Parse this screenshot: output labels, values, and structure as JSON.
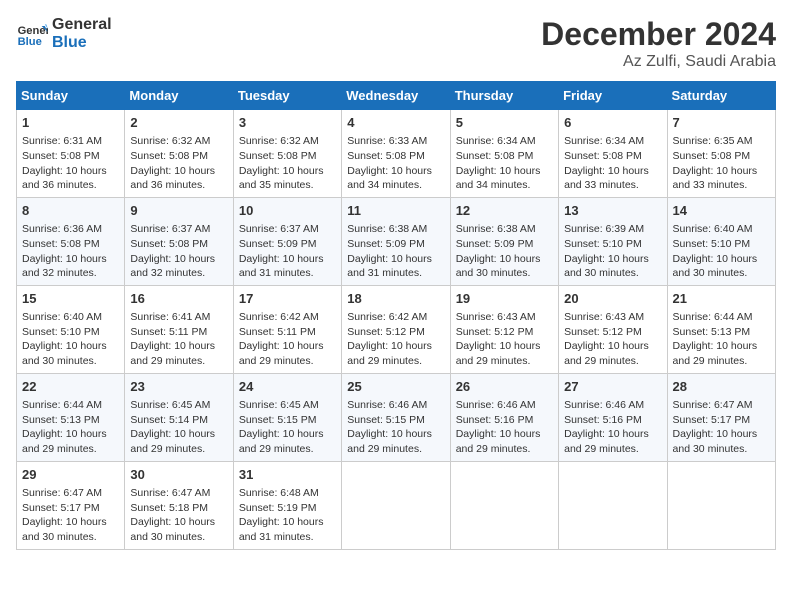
{
  "header": {
    "logo_line1": "General",
    "logo_line2": "Blue",
    "title": "December 2024",
    "subtitle": "Az Zulfi, Saudi Arabia"
  },
  "weekdays": [
    "Sunday",
    "Monday",
    "Tuesday",
    "Wednesday",
    "Thursday",
    "Friday",
    "Saturday"
  ],
  "weeks": [
    [
      {
        "day": "1",
        "info": "Sunrise: 6:31 AM\nSunset: 5:08 PM\nDaylight: 10 hours and 36 minutes."
      },
      {
        "day": "2",
        "info": "Sunrise: 6:32 AM\nSunset: 5:08 PM\nDaylight: 10 hours and 36 minutes."
      },
      {
        "day": "3",
        "info": "Sunrise: 6:32 AM\nSunset: 5:08 PM\nDaylight: 10 hours and 35 minutes."
      },
      {
        "day": "4",
        "info": "Sunrise: 6:33 AM\nSunset: 5:08 PM\nDaylight: 10 hours and 34 minutes."
      },
      {
        "day": "5",
        "info": "Sunrise: 6:34 AM\nSunset: 5:08 PM\nDaylight: 10 hours and 34 minutes."
      },
      {
        "day": "6",
        "info": "Sunrise: 6:34 AM\nSunset: 5:08 PM\nDaylight: 10 hours and 33 minutes."
      },
      {
        "day": "7",
        "info": "Sunrise: 6:35 AM\nSunset: 5:08 PM\nDaylight: 10 hours and 33 minutes."
      }
    ],
    [
      {
        "day": "8",
        "info": "Sunrise: 6:36 AM\nSunset: 5:08 PM\nDaylight: 10 hours and 32 minutes."
      },
      {
        "day": "9",
        "info": "Sunrise: 6:37 AM\nSunset: 5:08 PM\nDaylight: 10 hours and 32 minutes."
      },
      {
        "day": "10",
        "info": "Sunrise: 6:37 AM\nSunset: 5:09 PM\nDaylight: 10 hours and 31 minutes."
      },
      {
        "day": "11",
        "info": "Sunrise: 6:38 AM\nSunset: 5:09 PM\nDaylight: 10 hours and 31 minutes."
      },
      {
        "day": "12",
        "info": "Sunrise: 6:38 AM\nSunset: 5:09 PM\nDaylight: 10 hours and 30 minutes."
      },
      {
        "day": "13",
        "info": "Sunrise: 6:39 AM\nSunset: 5:10 PM\nDaylight: 10 hours and 30 minutes."
      },
      {
        "day": "14",
        "info": "Sunrise: 6:40 AM\nSunset: 5:10 PM\nDaylight: 10 hours and 30 minutes."
      }
    ],
    [
      {
        "day": "15",
        "info": "Sunrise: 6:40 AM\nSunset: 5:10 PM\nDaylight: 10 hours and 30 minutes."
      },
      {
        "day": "16",
        "info": "Sunrise: 6:41 AM\nSunset: 5:11 PM\nDaylight: 10 hours and 29 minutes."
      },
      {
        "day": "17",
        "info": "Sunrise: 6:42 AM\nSunset: 5:11 PM\nDaylight: 10 hours and 29 minutes."
      },
      {
        "day": "18",
        "info": "Sunrise: 6:42 AM\nSunset: 5:12 PM\nDaylight: 10 hours and 29 minutes."
      },
      {
        "day": "19",
        "info": "Sunrise: 6:43 AM\nSunset: 5:12 PM\nDaylight: 10 hours and 29 minutes."
      },
      {
        "day": "20",
        "info": "Sunrise: 6:43 AM\nSunset: 5:12 PM\nDaylight: 10 hours and 29 minutes."
      },
      {
        "day": "21",
        "info": "Sunrise: 6:44 AM\nSunset: 5:13 PM\nDaylight: 10 hours and 29 minutes."
      }
    ],
    [
      {
        "day": "22",
        "info": "Sunrise: 6:44 AM\nSunset: 5:13 PM\nDaylight: 10 hours and 29 minutes."
      },
      {
        "day": "23",
        "info": "Sunrise: 6:45 AM\nSunset: 5:14 PM\nDaylight: 10 hours and 29 minutes."
      },
      {
        "day": "24",
        "info": "Sunrise: 6:45 AM\nSunset: 5:15 PM\nDaylight: 10 hours and 29 minutes."
      },
      {
        "day": "25",
        "info": "Sunrise: 6:46 AM\nSunset: 5:15 PM\nDaylight: 10 hours and 29 minutes."
      },
      {
        "day": "26",
        "info": "Sunrise: 6:46 AM\nSunset: 5:16 PM\nDaylight: 10 hours and 29 minutes."
      },
      {
        "day": "27",
        "info": "Sunrise: 6:46 AM\nSunset: 5:16 PM\nDaylight: 10 hours and 29 minutes."
      },
      {
        "day": "28",
        "info": "Sunrise: 6:47 AM\nSunset: 5:17 PM\nDaylight: 10 hours and 30 minutes."
      }
    ],
    [
      {
        "day": "29",
        "info": "Sunrise: 6:47 AM\nSunset: 5:17 PM\nDaylight: 10 hours and 30 minutes."
      },
      {
        "day": "30",
        "info": "Sunrise: 6:47 AM\nSunset: 5:18 PM\nDaylight: 10 hours and 30 minutes."
      },
      {
        "day": "31",
        "info": "Sunrise: 6:48 AM\nSunset: 5:19 PM\nDaylight: 10 hours and 31 minutes."
      },
      null,
      null,
      null,
      null
    ]
  ]
}
